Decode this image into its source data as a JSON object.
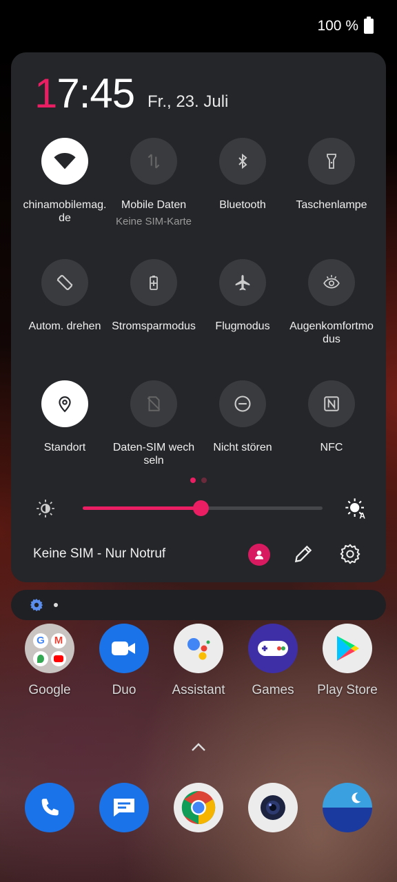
{
  "status": {
    "battery": "100 %"
  },
  "clock": {
    "hour_first": "1",
    "rest": "7:45",
    "date": "Fr., 23. Juli"
  },
  "tiles": [
    {
      "label": "chinamobilemag.de",
      "sub": "",
      "icon": "wifi-icon",
      "on": true
    },
    {
      "label": "Mobile Daten",
      "sub": "Keine SIM-Karte",
      "icon": "mobile-data-icon",
      "on": false
    },
    {
      "label": "Bluetooth",
      "sub": "",
      "icon": "bluetooth-icon",
      "on": false
    },
    {
      "label": "Taschenlampe",
      "sub": "",
      "icon": "flashlight-icon",
      "on": false
    },
    {
      "label": "Autom. drehen",
      "sub": "",
      "icon": "auto-rotate-icon",
      "on": false
    },
    {
      "label": "Stromsparmodus",
      "sub": "",
      "icon": "battery-saver-icon",
      "on": false
    },
    {
      "label": "Flugmodus",
      "sub": "",
      "icon": "airplane-icon",
      "on": false
    },
    {
      "label": "Augenkomfortmodus",
      "sub": "",
      "icon": "eye-comfort-icon",
      "on": false
    },
    {
      "label": "Standort",
      "sub": "",
      "icon": "location-icon",
      "on": true
    },
    {
      "label": "Daten-SIM wechseln",
      "sub": "",
      "icon": "sim-switch-icon",
      "on": false
    },
    {
      "label": "Nicht stören",
      "sub": "",
      "icon": "do-not-disturb-icon",
      "on": false
    },
    {
      "label": "NFC",
      "sub": "",
      "icon": "nfc-icon",
      "on": false
    }
  ],
  "brightness": {
    "level": 0.49,
    "accent": "#e91e63"
  },
  "footer": {
    "status_text": "Keine SIM - Nur Notruf"
  },
  "apps": [
    {
      "name": "Google",
      "icon": "google-folder-icon"
    },
    {
      "name": "Duo",
      "icon": "duo-icon"
    },
    {
      "name": "Assistant",
      "icon": "assistant-icon"
    },
    {
      "name": "Games",
      "icon": "games-icon"
    },
    {
      "name": "Play Store",
      "icon": "play-store-icon"
    }
  ],
  "dock": [
    {
      "icon": "phone-icon"
    },
    {
      "icon": "messages-icon"
    },
    {
      "icon": "chrome-icon"
    },
    {
      "icon": "camera-icon"
    },
    {
      "icon": "weather-icon"
    }
  ]
}
